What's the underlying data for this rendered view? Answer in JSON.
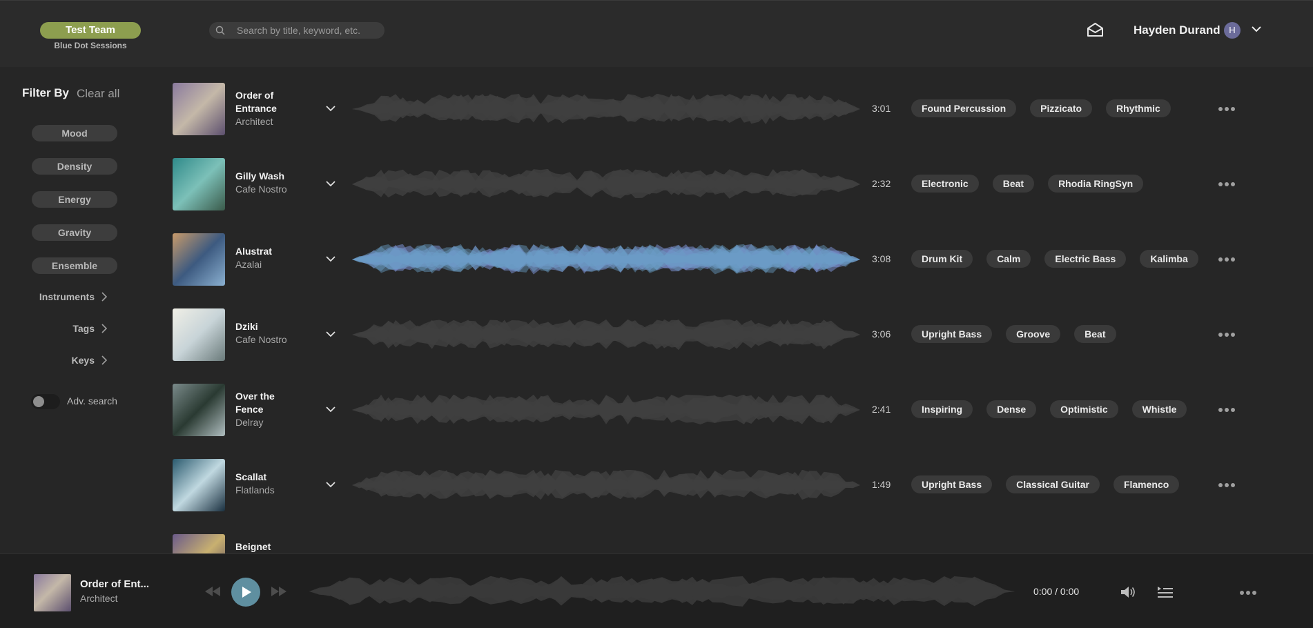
{
  "header": {
    "team_label": "Test Team",
    "team_sub": "Blue Dot Sessions",
    "search_placeholder": "Search by title, keyword, etc.",
    "user_name": "Hayden Durand",
    "avatar_initial": "H"
  },
  "sidebar": {
    "filter_title": "Filter By",
    "clear_all": "Clear all",
    "filters": [
      "Mood",
      "Density",
      "Energy",
      "Gravity",
      "Ensemble"
    ],
    "expandables": [
      "Instruments",
      "Tags",
      "Keys"
    ],
    "adv_search": "Adv. search",
    "adv_search_enabled": false
  },
  "tracks": [
    {
      "title": "Order of Entrance",
      "artist": "Architect",
      "duration": "3:01",
      "tags": [
        "Found Percussion",
        "Pizzicato",
        "Rhythmic"
      ],
      "active": false,
      "art": [
        "#8a7a9e",
        "#c4b8a8",
        "#5c4f6e"
      ]
    },
    {
      "title": "Gilly Wash",
      "artist": "Cafe Nostro",
      "duration": "2:32",
      "tags": [
        "Electronic",
        "Beat",
        "Rhodia RingSyn"
      ],
      "active": false,
      "art": [
        "#2f8a8a",
        "#7cc0b8",
        "#3a5a4a"
      ]
    },
    {
      "title": "Alustrat",
      "artist": "Azalai",
      "duration": "3:08",
      "tags": [
        "Drum Kit",
        "Calm",
        "Electric Bass",
        "Kalimba"
      ],
      "active": true,
      "art": [
        "#c89a6a",
        "#3d5a80",
        "#8ab0d0"
      ]
    },
    {
      "title": "Dziki",
      "artist": "Cafe Nostro",
      "duration": "3:06",
      "tags": [
        "Upright Bass",
        "Groove",
        "Beat"
      ],
      "active": false,
      "art": [
        "#f0efe6",
        "#c8d4d8",
        "#6a7a7a"
      ]
    },
    {
      "title": "Over the Fence",
      "artist": "Delray",
      "duration": "2:41",
      "tags": [
        "Inspiring",
        "Dense",
        "Optimistic",
        "Whistle"
      ],
      "active": false,
      "art": [
        "#7a8a8a",
        "#2a3a32",
        "#b0bec0"
      ]
    },
    {
      "title": "Scallat",
      "artist": "Flatlands",
      "duration": "1:49",
      "tags": [
        "Upright Bass",
        "Classical Guitar",
        "Flamenco"
      ],
      "active": false,
      "art": [
        "#2a5a6e",
        "#c0d8e0",
        "#1a3040"
      ]
    },
    {
      "title": "Beignet Interlude",
      "artist": "",
      "duration": "",
      "tags": [],
      "active": false,
      "art": [
        "#6a5a8a",
        "#c8b070",
        "#4a3a5a"
      ]
    }
  ],
  "player": {
    "title": "Order of Ent...",
    "artist": "Architect",
    "time": "0:00 / 0:00"
  },
  "colors": {
    "team_pill": "#8d9e4f",
    "play_button": "#5f8fa0",
    "wave_idle": "#3f3f3f",
    "wave_active": "#7a8fd0"
  },
  "icons": [
    "search-icon",
    "mail-icon",
    "chevron-down-icon",
    "chevron-right-icon",
    "more-icon",
    "rewind-icon",
    "play-icon",
    "fast-forward-icon",
    "volume-icon",
    "queue-icon"
  ]
}
